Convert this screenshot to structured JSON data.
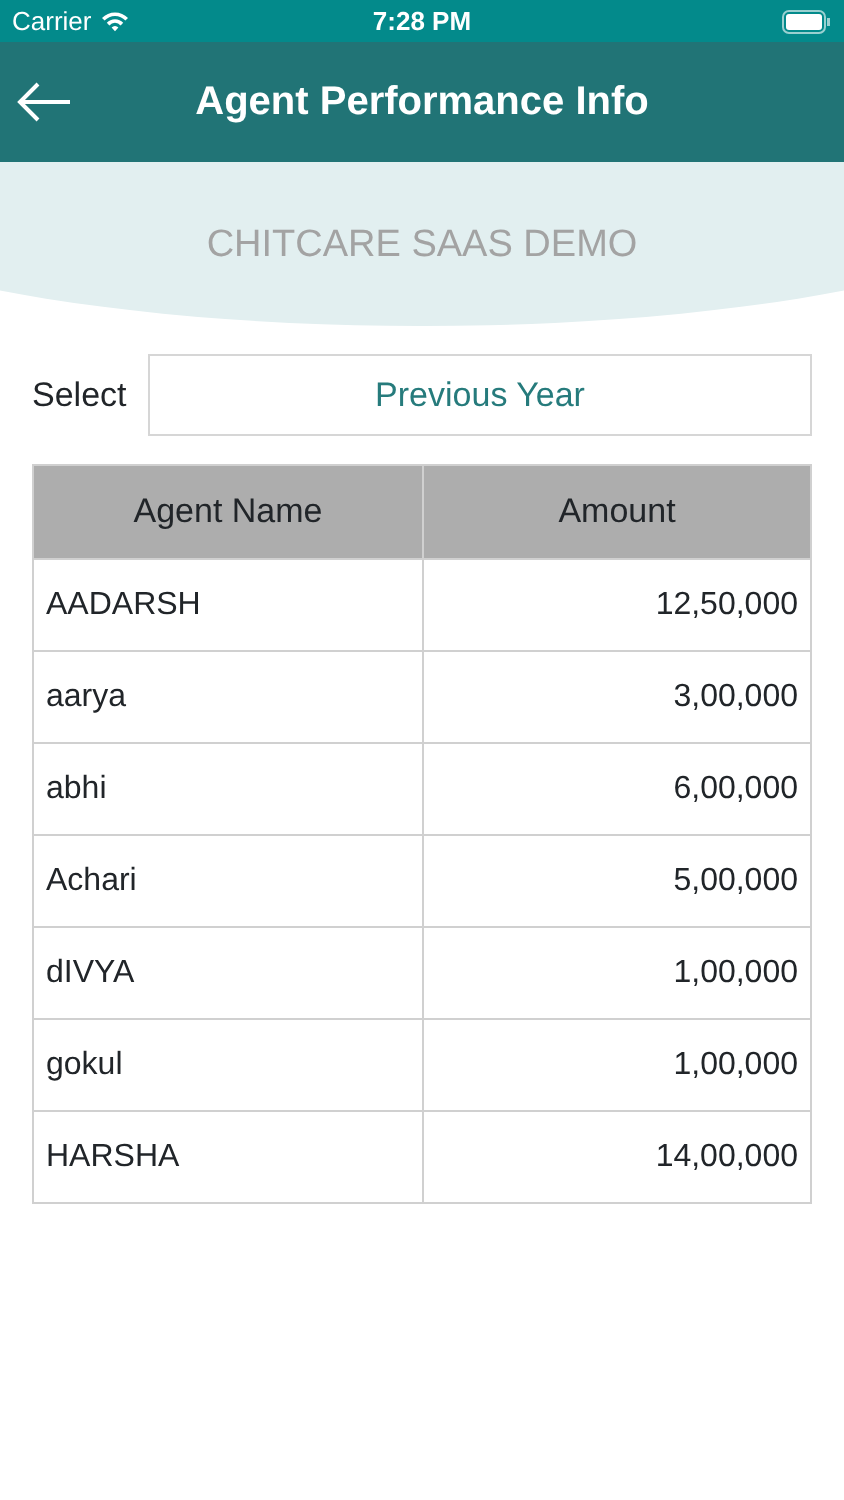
{
  "status_bar": {
    "carrier": "Carrier",
    "time": "7:28 PM"
  },
  "header": {
    "title": "Agent Performance Info"
  },
  "company": "CHITCARE SAAS DEMO",
  "filter": {
    "label": "Select",
    "value": "Previous Year"
  },
  "table": {
    "columns": [
      "Agent Name",
      "Amount"
    ],
    "rows": [
      {
        "name": "AADARSH",
        "amount": "12,50,000"
      },
      {
        "name": "aarya",
        "amount": "3,00,000"
      },
      {
        "name": "abhi",
        "amount": "6,00,000"
      },
      {
        "name": "Achari",
        "amount": "5,00,000"
      },
      {
        "name": "dIVYA",
        "amount": "1,00,000"
      },
      {
        "name": "gokul",
        "amount": "1,00,000"
      },
      {
        "name": "HARSHA",
        "amount": "14,00,000"
      }
    ]
  }
}
